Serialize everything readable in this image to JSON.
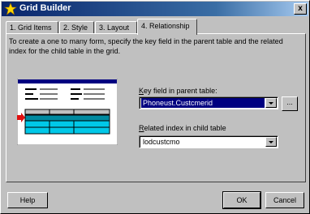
{
  "window": {
    "title": "Grid Builder",
    "close_glyph": "x"
  },
  "tabs": [
    {
      "label": "1. Grid Items",
      "active": false
    },
    {
      "label": "2. Style",
      "active": false
    },
    {
      "label": "3. Layout",
      "active": false
    },
    {
      "label": "4. Relationship",
      "active": true
    }
  ],
  "description": "To create a one to many form, specify the key field in the parent table and the related index for the child table in the grid.",
  "key_field": {
    "label_underlined": "K",
    "label_rest": "ey field in parent table:",
    "value": "Phoneust.Custcmerid",
    "browse_label": "..."
  },
  "related_index": {
    "label_underlined": "R",
    "label_rest": "elated index in child table",
    "value": "lodcustcmo"
  },
  "buttons": {
    "help": "Help",
    "ok": "OK",
    "cancel": "Cancel"
  },
  "colors": {
    "title_start": "#08246b",
    "title_end": "#a6caf0",
    "selection": "#000080",
    "grid_highlight": "#00c8e8",
    "arrow": "#e01010"
  },
  "icons": {
    "title": "star-app-icon",
    "close": "close-icon",
    "dropdown": "chevron-down-icon"
  }
}
